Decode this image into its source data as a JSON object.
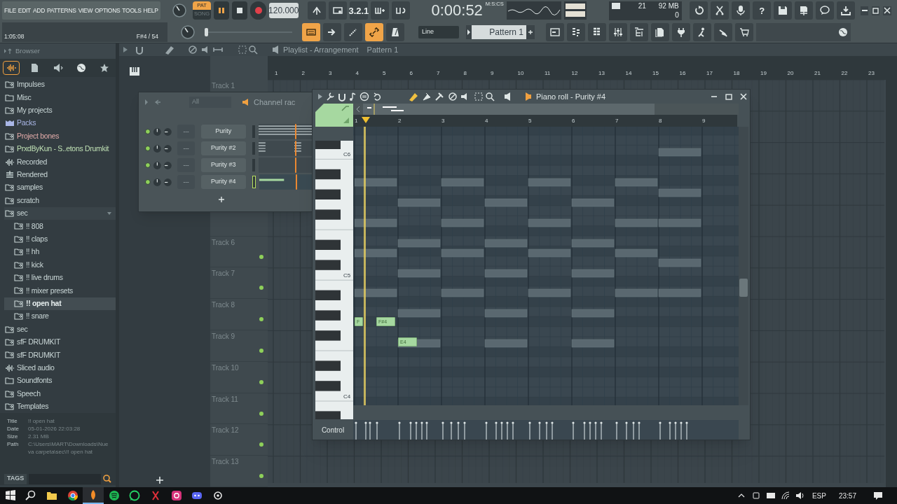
{
  "menu": [
    "FILE",
    "EDIT",
    "ADD",
    "PATTERNS",
    "VIEW",
    "OPTIONS",
    "TOOLS",
    "HELP"
  ],
  "transport": {
    "mode_top": "PAT",
    "mode_bottom": "SONG",
    "pat_selected": true,
    "playing": true,
    "tempo": "120.000",
    "time": "0:00:52",
    "time_unit": "M:S:CS"
  },
  "hint_bar": {
    "position": "1:05:08",
    "note": "F#4 / 54"
  },
  "toolbar_modes": [
    {
      "on": false
    },
    {
      "on": false
    },
    {
      "label": "3.2.1",
      "on": false
    },
    {
      "on": false
    },
    {
      "on": false
    }
  ],
  "cpu": {
    "voices": "21",
    "memory": "92 MB",
    "polyphony": "0"
  },
  "help_label": "?",
  "toolbar_second": [
    {
      "on": true
    },
    {
      "on": false
    },
    {
      "on": false
    },
    {
      "on": true
    },
    {
      "on": false
    }
  ],
  "master_pitch": {
    "level": 0.02
  },
  "snap": "Line",
  "pattern": "Pattern 1",
  "browser": {
    "title": "Browser",
    "tabs": [
      {
        "selected": true
      },
      {
        "selected": false
      },
      {
        "selected": false
      },
      {
        "selected": false
      },
      {
        "selected": false
      }
    ],
    "items": [
      {
        "label": "Impulses",
        "kind": "linked",
        "color": "#c9d6d6",
        "selected": false
      },
      {
        "label": "Misc",
        "kind": "folder",
        "color": "#c9d6d6",
        "selected": false
      },
      {
        "label": "My projects",
        "kind": "linked",
        "selected": false
      },
      {
        "label": "Packs",
        "kind": "pack",
        "color": "#a9b6e6",
        "selected": false
      },
      {
        "label": "Project bones",
        "kind": "linked",
        "color": "#e0aaa8",
        "selected": false
      },
      {
        "label": "PrxdByKun - S..etons Drumkit",
        "kind": "linked",
        "color": "#bfe0b4",
        "selected": false
      },
      {
        "label": "Recorded",
        "kind": "audio",
        "color": "#c9d6d6",
        "selected": false
      },
      {
        "label": "Rendered",
        "kind": "render",
        "color": "#c9d6d6",
        "selected": false
      },
      {
        "label": "samples",
        "kind": "linked",
        "color": "#c9d6d6",
        "selected": false
      },
      {
        "label": "scratch",
        "kind": "linked",
        "color": "#c9d6d6",
        "selected": false
      },
      {
        "label": "sec",
        "kind": "linked",
        "color": "#c9d6d6",
        "selected": false,
        "expanded": true,
        "children": [
          {
            "label": "!! 808",
            "kind": "linked",
            "color": "#c9d6d6",
            "selected": false
          },
          {
            "label": "!! claps",
            "kind": "linked",
            "color": "#c9d6d6",
            "selected": false
          },
          {
            "label": "!! hh",
            "kind": "linked",
            "color": "#c9d6d6",
            "selected": false
          },
          {
            "label": "!! kick",
            "kind": "linked",
            "color": "#c9d6d6",
            "selected": false
          },
          {
            "label": "!! live drums",
            "kind": "linked",
            "color": "#c9d6d6",
            "selected": false
          },
          {
            "label": "!! mixer presets",
            "kind": "linked",
            "color": "#c9d6d6",
            "selected": false
          },
          {
            "label": "!! open hat",
            "kind": "linked",
            "color": "#e8f0f0",
            "selected": true
          },
          {
            "label": "!! snare",
            "kind": "linked",
            "color": "#c9d6d6",
            "selected": false
          }
        ]
      },
      {
        "label": "sec",
        "kind": "linked",
        "color": "#c9d6d6",
        "selected": false
      },
      {
        "label": "sfF DRUMKIT",
        "kind": "linked",
        "color": "#c9d6d6",
        "selected": false
      },
      {
        "label": "sfF DRUMKIT",
        "kind": "linked",
        "color": "#c9d6d6",
        "selected": false
      },
      {
        "label": "Sliced audio",
        "kind": "audio",
        "color": "#c9d6d6",
        "selected": false
      },
      {
        "label": "Soundfonts",
        "kind": "folder",
        "color": "#c9d6d6",
        "selected": false
      },
      {
        "label": "Speech",
        "kind": "linked",
        "color": "#c9d6d6",
        "selected": false
      },
      {
        "label": "Templates",
        "kind": "linked",
        "color": "#c9d6d6",
        "selected": false
      }
    ],
    "info": [
      {
        "key": "Title",
        "value": "!! open hat"
      },
      {
        "key": "Date",
        "value": "05-01-2026 22:03:28"
      },
      {
        "key": "Size",
        "value": "2.31 MB"
      },
      {
        "key": "Path",
        "value": "C:\\Users\\MART\\Downloads\\Nueva carpeta\\sec\\!! open hat"
      }
    ],
    "tags": "TAGS"
  },
  "playlist": {
    "title": "Playlist - Arrangement",
    "pattern": "Pattern 1",
    "ruler": [
      "1",
      "2",
      "3",
      "4",
      "5",
      "6",
      "7",
      "8",
      "9",
      "10",
      "11",
      "12",
      "13",
      "14",
      "15",
      "16",
      "17",
      "18",
      "19",
      "20",
      "21",
      "22",
      "23"
    ],
    "tracks": [
      "Track 1",
      "Track 6",
      "Track 7",
      "Track 8",
      "Track 9",
      "Track 10",
      "Track 11",
      "Track 12",
      "Track 13"
    ]
  },
  "channel_rack": {
    "title": "Channel rac",
    "filter": "All",
    "channels": [
      {
        "name": "Purity",
        "mixer": "---",
        "selected": false
      },
      {
        "name": "Purity #2",
        "mixer": "---",
        "selected": false
      },
      {
        "name": "Purity #3",
        "mixer": "---",
        "selected": false
      },
      {
        "name": "Purity #4",
        "mixer": "---",
        "selected": true
      }
    ]
  },
  "piano_roll": {
    "title": "Piano roll - Purity #4",
    "ruler": [
      "1",
      "2",
      "3",
      "4",
      "5",
      "6",
      "7",
      "8",
      "9"
    ],
    "key_labels": [
      "C6",
      "C5",
      "C4"
    ],
    "notes": [
      {
        "label": "F"
      },
      {
        "label": "F#4"
      },
      {
        "label": "E4"
      }
    ],
    "control": "Control"
  },
  "taskbar": {
    "apps": [
      {
        "selected": false
      },
      {
        "selected": false
      },
      {
        "selected": false
      },
      {
        "selected": false
      },
      {
        "selected": true
      },
      {
        "selected": false
      },
      {
        "selected": false
      },
      {
        "selected": false
      },
      {
        "selected": false
      },
      {
        "selected": false
      },
      {
        "selected": false
      }
    ],
    "language": "ESP",
    "clock": "23:57"
  }
}
